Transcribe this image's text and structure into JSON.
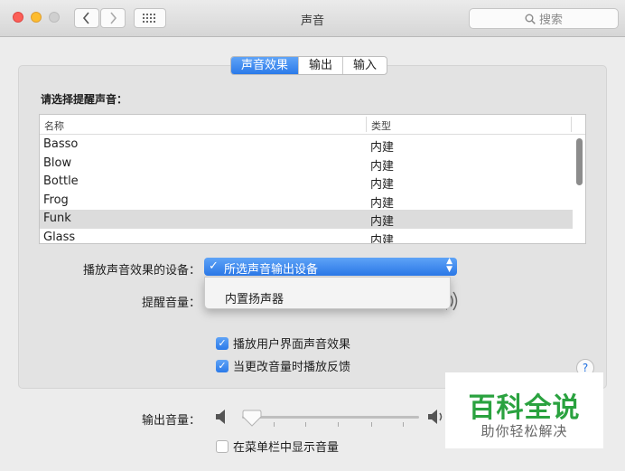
{
  "window": {
    "title": "声音"
  },
  "toolbar": {
    "search_placeholder": "搜索"
  },
  "tabs": [
    {
      "label": "声音效果",
      "active": true
    },
    {
      "label": "输出",
      "active": false
    },
    {
      "label": "输入",
      "active": false
    }
  ],
  "alert": {
    "heading": "请选择提醒声音：",
    "columns": {
      "name": "名称",
      "type": "类型"
    },
    "rows": [
      {
        "name": "Basso",
        "type": "内建",
        "selected": false
      },
      {
        "name": "Blow",
        "type": "内建",
        "selected": false
      },
      {
        "name": "Bottle",
        "type": "内建",
        "selected": false
      },
      {
        "name": "Frog",
        "type": "内建",
        "selected": false
      },
      {
        "name": "Funk",
        "type": "内建",
        "selected": true
      },
      {
        "name": "Glass",
        "type": "内建",
        "selected": false
      }
    ]
  },
  "play_device": {
    "label": "播放声音效果的设备：",
    "selected": "所选声音输出设备",
    "options": [
      "内置扬声器"
    ]
  },
  "alert_volume": {
    "label": "提醒音量："
  },
  "checkboxes": [
    {
      "label": "播放用户界面声音效果",
      "checked": true
    },
    {
      "label": "当更改音量时播放反馈",
      "checked": true
    }
  ],
  "output_volume": {
    "label": "输出音量：",
    "level": 0.0
  },
  "menubar_checkbox": {
    "label": "在菜单栏中显示音量",
    "checked": false
  },
  "help": {
    "symbol": "?"
  },
  "watermark": {
    "title": "百科全说",
    "subtitle": "助你轻松解决"
  },
  "colors": {
    "accent": "#2b7ae9",
    "watermark_green": "#2aa23f"
  }
}
